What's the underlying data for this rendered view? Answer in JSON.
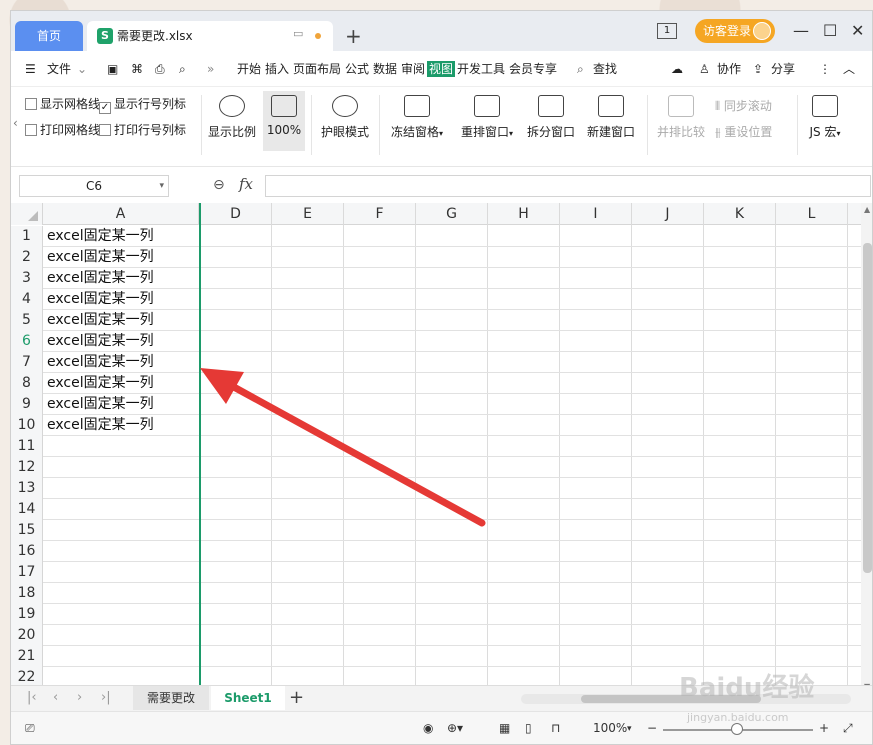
{
  "tabs": {
    "home": "首页",
    "file": "需要更改.xlsx"
  },
  "titlebar": {
    "badge_1": "1",
    "login": "访客登录"
  },
  "menu": [
    "文件",
    "开始",
    "插入",
    "页面布局",
    "公式",
    "数据",
    "审阅",
    "视图",
    "开发工具",
    "会员专享"
  ],
  "menu_right": {
    "search": "查找",
    "collab": "协作",
    "share": "分享"
  },
  "ribbon": {
    "show_grid": "显示网格线",
    "show_rowcol": "显示行号列标",
    "print_grid": "打印网格线",
    "print_rowcol": "打印行号列标",
    "zoom_ratio": "显示比例",
    "zoom_100": "100%",
    "eye_mode": "护眼模式",
    "freeze": "冻结窗格",
    "rearrange": "重排窗口",
    "split": "拆分窗口",
    "new_window": "新建窗口",
    "side_by_side": "并排比较",
    "sync_scroll": "同步滚动",
    "reset_pos": "重设位置",
    "js_macro": "JS 宏"
  },
  "formula_bar": {
    "cell_ref": "C6",
    "fx": "fx",
    "value": ""
  },
  "columns": [
    "A",
    "D",
    "E",
    "F",
    "G",
    "H",
    "I",
    "J",
    "K",
    "L"
  ],
  "rows": [
    "1",
    "2",
    "3",
    "4",
    "5",
    "6",
    "7",
    "8",
    "9",
    "10",
    "11",
    "12",
    "13",
    "14",
    "15",
    "16",
    "17",
    "18",
    "19",
    "20",
    "21",
    "22"
  ],
  "cells_A": [
    "excel固定某一列",
    "excel固定某一列",
    "excel固定某一列",
    "excel固定某一列",
    "excel固定某一列",
    "excel固定某一列",
    "excel固定某一列",
    "excel固定某一列",
    "excel固定某一列",
    "excel固定某一列"
  ],
  "selected_row": "6",
  "sheets": {
    "sheet_a": "需要更改",
    "sheet_b": "Sheet1"
  },
  "status": {
    "zoom": "100%"
  },
  "watermark": {
    "text": "Baidu经验",
    "sub": "jingyan.baidu.com"
  },
  "colors": {
    "accent": "#1c9b6a",
    "home_tab": "#5b8ff0",
    "login": "#f5a623",
    "arrow": "#e53935"
  }
}
